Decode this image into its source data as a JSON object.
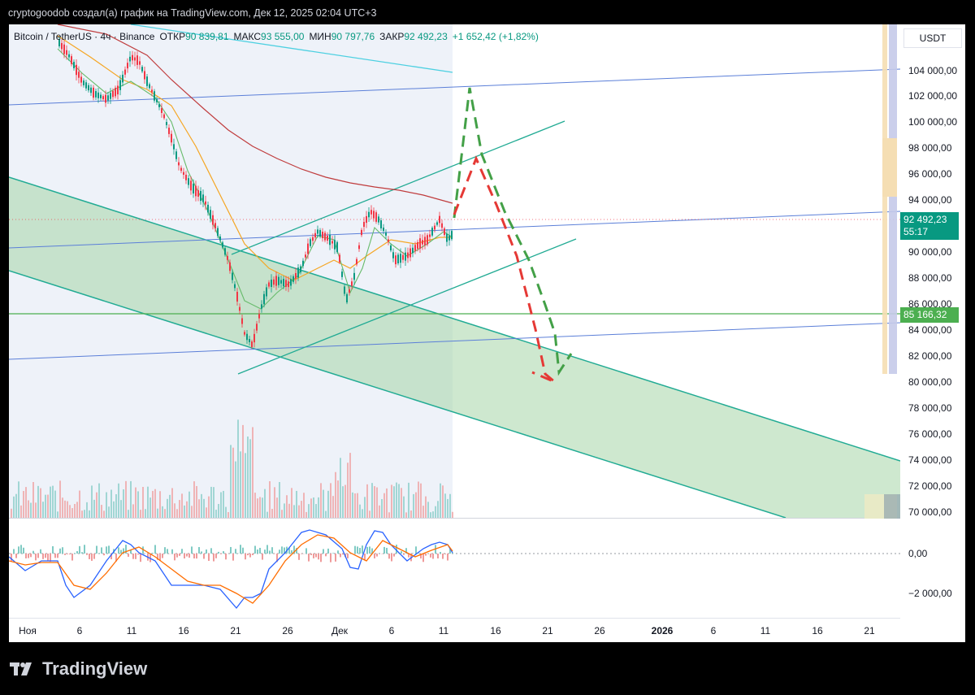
{
  "header": {
    "note": "cryptogoodob создал(а) график на TradingView.com, Дек 12, 2025 02:04 UTC+3"
  },
  "legend": {
    "symbol": "Bitcoin / TetherUS · 4ч · Binance",
    "open_label": "ОТКР",
    "open_value": "90 839,81",
    "high_label": "МАКС",
    "high_value": "93 555,00",
    "low_label": "МИН",
    "low_value": "90 797,76",
    "close_label": "ЗАКР",
    "close_value": "92 492,23",
    "change": "+1 652,42 (+1,82%)"
  },
  "price_scale": {
    "currency": "USDT",
    "ticks": [
      "104 000,00",
      "102 000,00",
      "100 000,00",
      "98 000,00",
      "96 000,00",
      "94 000,00",
      "90 000,00",
      "88 000,00",
      "86 000,00",
      "84 000,00",
      "82 000,00",
      "80 000,00",
      "78 000,00",
      "76 000,00",
      "74 000,00",
      "72 000,00",
      "70 000,00"
    ],
    "current_price": "92 492,23",
    "countdown": "55:17",
    "level_price": "85 166,32"
  },
  "oscillator_scale": {
    "ticks": [
      "0,00",
      "−2 000,00"
    ]
  },
  "time_axis": {
    "labels": [
      "Ноя",
      "6",
      "11",
      "16",
      "21",
      "26",
      "Дек",
      "6",
      "11",
      "16",
      "21",
      "26",
      "2026",
      "6",
      "11",
      "16",
      "21"
    ]
  },
  "brand": {
    "name": "TradingView"
  },
  "colors": {
    "up": "#089981",
    "down": "#f23645",
    "channel": "#22ab94",
    "channel_fill": "#a5d6a7",
    "trendline": "#5b7fd8",
    "level": "#4caf50",
    "projection_up": "#43a047",
    "projection_down": "#e53935",
    "macd": "#2962ff",
    "signal": "#ff6d00"
  }
}
